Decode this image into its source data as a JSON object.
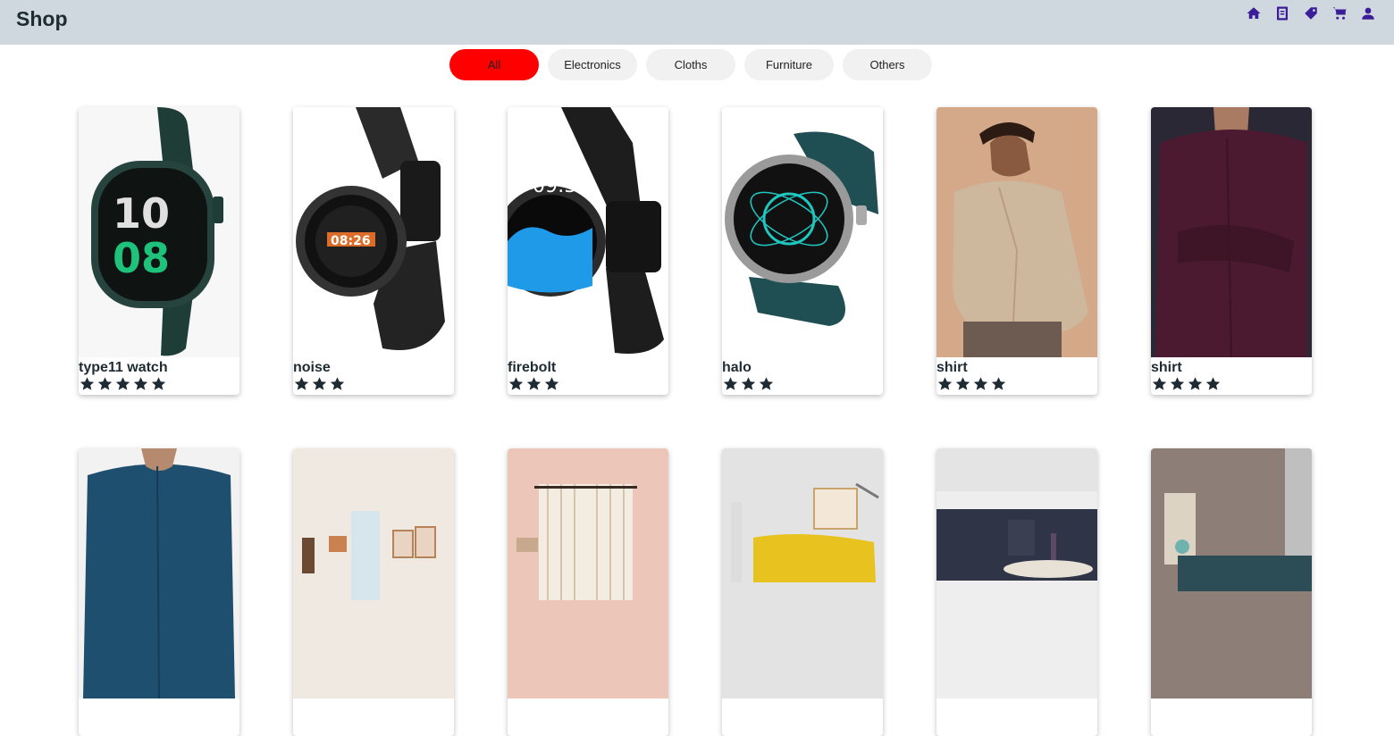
{
  "header": {
    "title": "Shop",
    "icons": [
      "home-icon",
      "contacts-icon",
      "tag-icon",
      "cart-icon",
      "user-icon"
    ],
    "icon_color": "#3b1d9a"
  },
  "filters": {
    "items": [
      "All",
      "Electronics",
      "Cloths",
      "Furniture",
      "Others"
    ],
    "active": "All",
    "active_color": "#ff0000"
  },
  "products": [
    {
      "name": "type11 watch",
      "rating": 5,
      "image": "green-smartwatch"
    },
    {
      "name": "noise",
      "rating": 3,
      "image": "black-orange-smartwatch"
    },
    {
      "name": "firebolt",
      "rating": 3,
      "image": "black-blue-smartwatch"
    },
    {
      "name": "halo",
      "rating": 3,
      "image": "teal-silver-smartwatch"
    },
    {
      "name": "shirt",
      "rating": 4,
      "image": "beige-shirt-model"
    },
    {
      "name": "shirt",
      "rating": 4,
      "image": "maroon-shirt-model"
    },
    {
      "name": "",
      "rating": 0,
      "image": "blue-shirt-model"
    },
    {
      "name": "",
      "rating": 0,
      "image": "light-living-room"
    },
    {
      "name": "",
      "rating": 0,
      "image": "pink-room-curtains"
    },
    {
      "name": "",
      "rating": 0,
      "image": "yellow-sofa-room"
    },
    {
      "name": "",
      "rating": 0,
      "image": "navy-sofa-coffee-tables"
    },
    {
      "name": "",
      "rating": 0,
      "image": "grey-room-sofa"
    }
  ]
}
